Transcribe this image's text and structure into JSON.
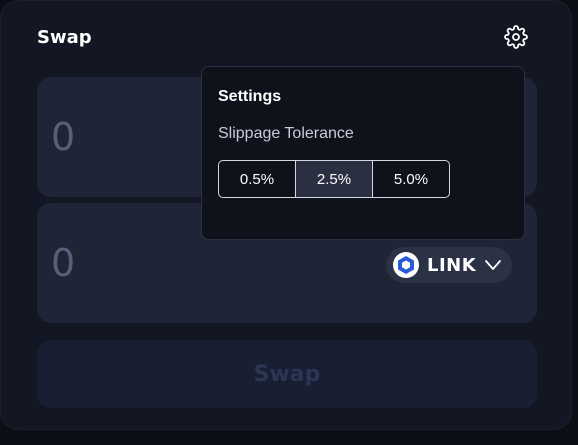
{
  "header": {
    "title": "Swap",
    "settings_icon": "gear-icon"
  },
  "from": {
    "amount": "0"
  },
  "to": {
    "amount": "0",
    "token": {
      "symbol": "LINK",
      "icon": "chainlink-icon",
      "color": "#2a5ada"
    }
  },
  "swap_button": {
    "label": "Swap"
  },
  "settings": {
    "title": "Settings",
    "slippage_label": "Slippage Tolerance",
    "options": [
      "0.5%",
      "2.5%",
      "5.0%"
    ],
    "selected": "2.5%"
  },
  "colors": {
    "background": "#0c0e15",
    "card": "#131724",
    "input": "#1f2436",
    "button_disabled": "#191f33"
  }
}
